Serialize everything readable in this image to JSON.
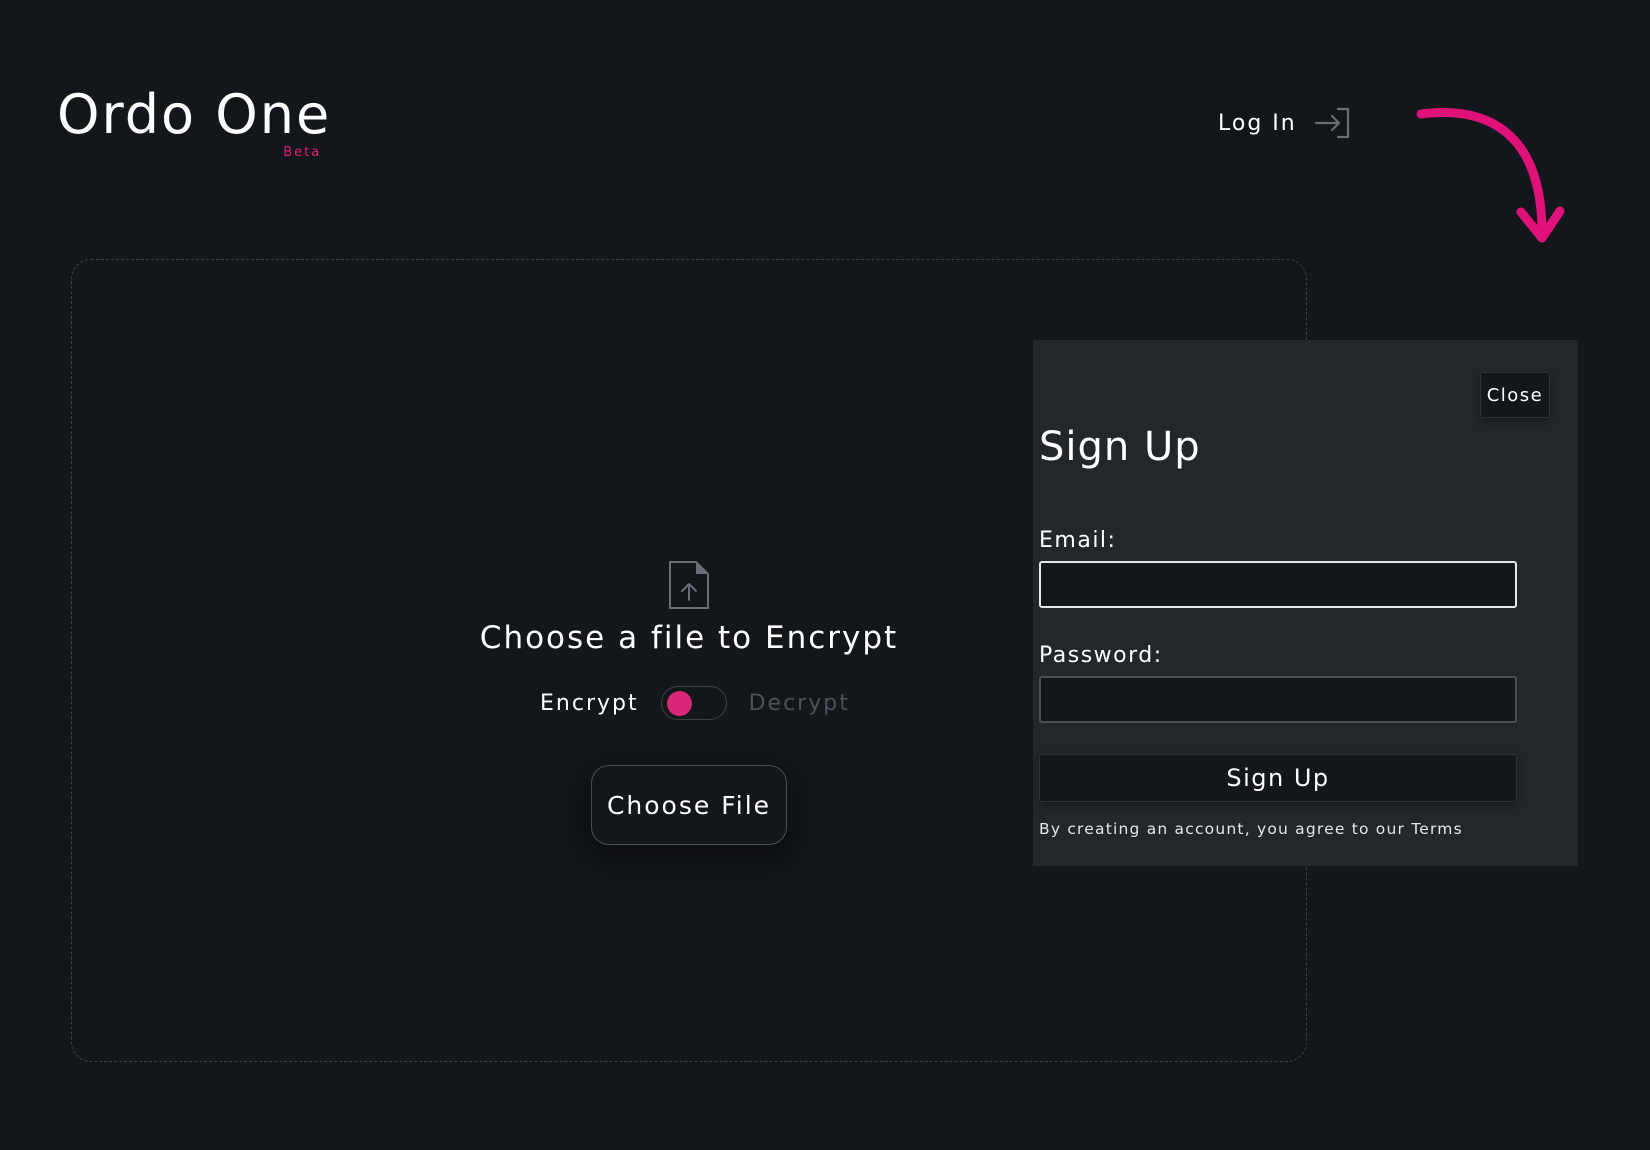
{
  "brand": {
    "name": "Ordo One",
    "badge": "Beta"
  },
  "header": {
    "login_label": "Log In",
    "login_icon": "login-arrow-icon"
  },
  "dropzone": {
    "icon": "file-upload-icon",
    "title": "Choose a file to Encrypt",
    "mode_left_label": "Encrypt",
    "mode_right_label": "Decrypt",
    "mode_selected": "Encrypt",
    "choose_file_label": "Choose File"
  },
  "signup": {
    "close_label": "Close",
    "title": "Sign Up",
    "email_label": "Email:",
    "email_value": "",
    "password_label": "Password:",
    "password_value": "",
    "submit_label": "Sign Up",
    "terms_text": "By creating an account, you agree to our ",
    "terms_link": "Terms"
  },
  "colors": {
    "background": "#13161a",
    "panel": "#23272b",
    "accent": "#e0217a",
    "text": "#ffffff",
    "muted": "#4d5157"
  }
}
